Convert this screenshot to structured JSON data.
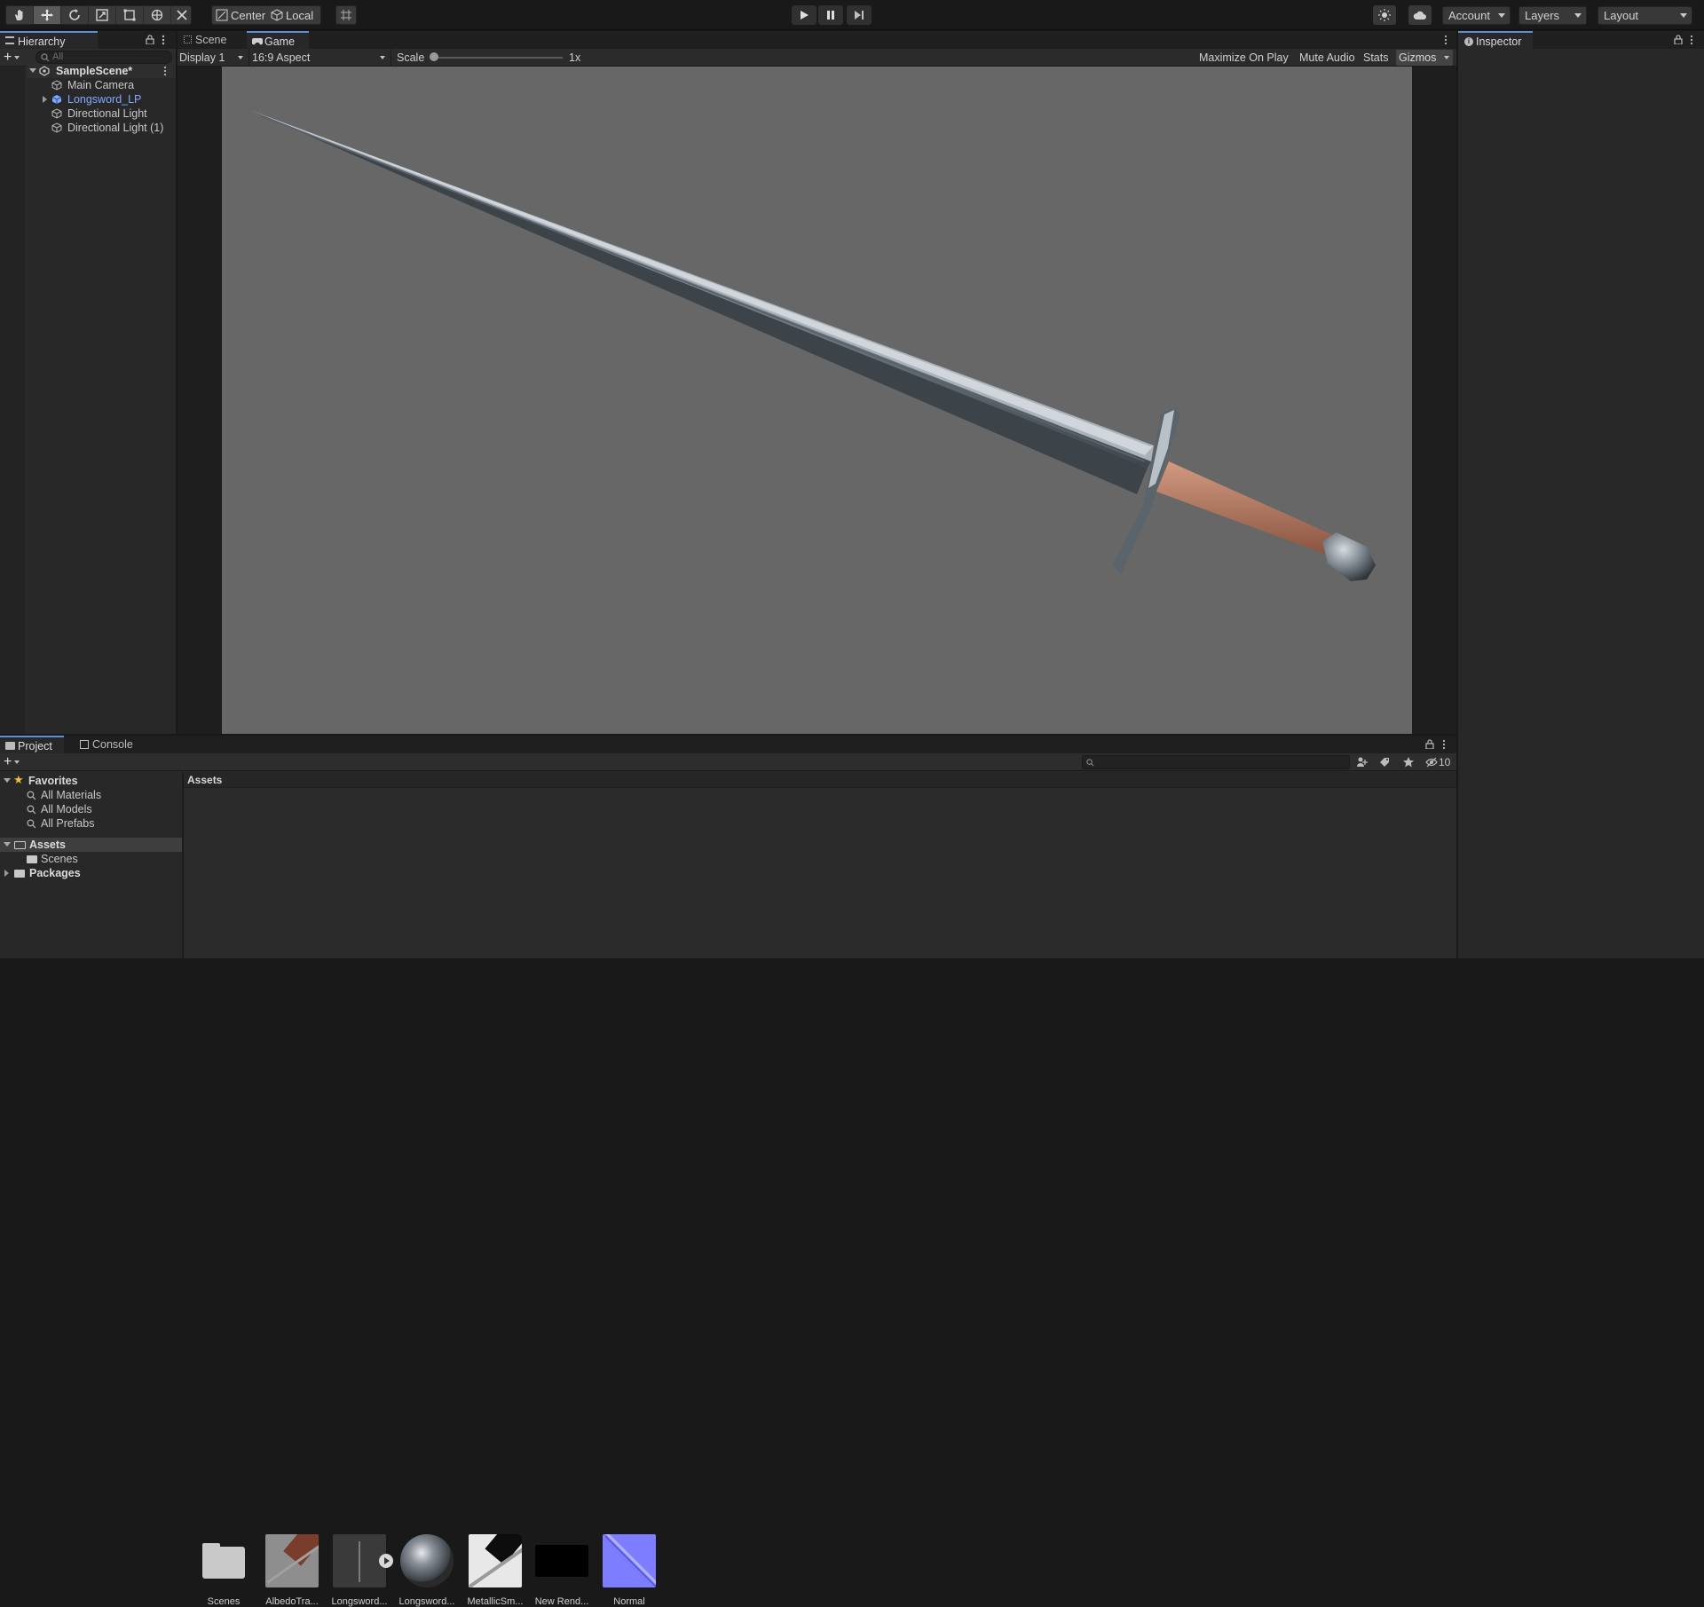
{
  "toolbar": {
    "tools": [
      "hand-tool-icon",
      "move-tool-icon",
      "rotate-tool-icon",
      "scale-tool-icon",
      "rect-tool-icon",
      "transform-tool-icon",
      "custom-tool-icon"
    ],
    "pivot_label": "Center",
    "space_label": "Local",
    "account_label": "Account",
    "layers_label": "Layers",
    "layout_label": "Layout"
  },
  "hierarchy": {
    "tab_label": "Hierarchy",
    "search_placeholder": "All",
    "scene_name": "SampleScene*",
    "items": [
      "Main Camera",
      "Longsword_LP",
      "Directional Light",
      "Directional Light (1)"
    ]
  },
  "game": {
    "tabs": [
      "Scene",
      "Game"
    ],
    "display_label": "Display 1",
    "aspect_label": "16:9 Aspect",
    "scale_label": "Scale",
    "scale_value": "1x",
    "maximize_label": "Maximize On Play",
    "mute_label": "Mute Audio",
    "stats_label": "Stats",
    "gizmos_label": "Gizmos"
  },
  "inspector": {
    "tab_label": "Inspector"
  },
  "project": {
    "tabs": [
      "Project",
      "Console"
    ],
    "favorites_label": "Favorites",
    "favorites": [
      "All Materials",
      "All Models",
      "All Prefabs"
    ],
    "assets_label": "Assets",
    "scenes_label": "Scenes",
    "packages_label": "Packages",
    "breadcrumb": "Assets",
    "hidden_count": "10",
    "assets": [
      "Scenes",
      "AlbedoTra...",
      "Longsword...",
      "Longsword...",
      "MetallicSm...",
      "New Rend...",
      "Normal"
    ]
  },
  "colors": {
    "accent": "#5a8fd8",
    "viewport": "#676767",
    "prefab": "#7fa9ff",
    "normal_map": "#7d7dff"
  }
}
